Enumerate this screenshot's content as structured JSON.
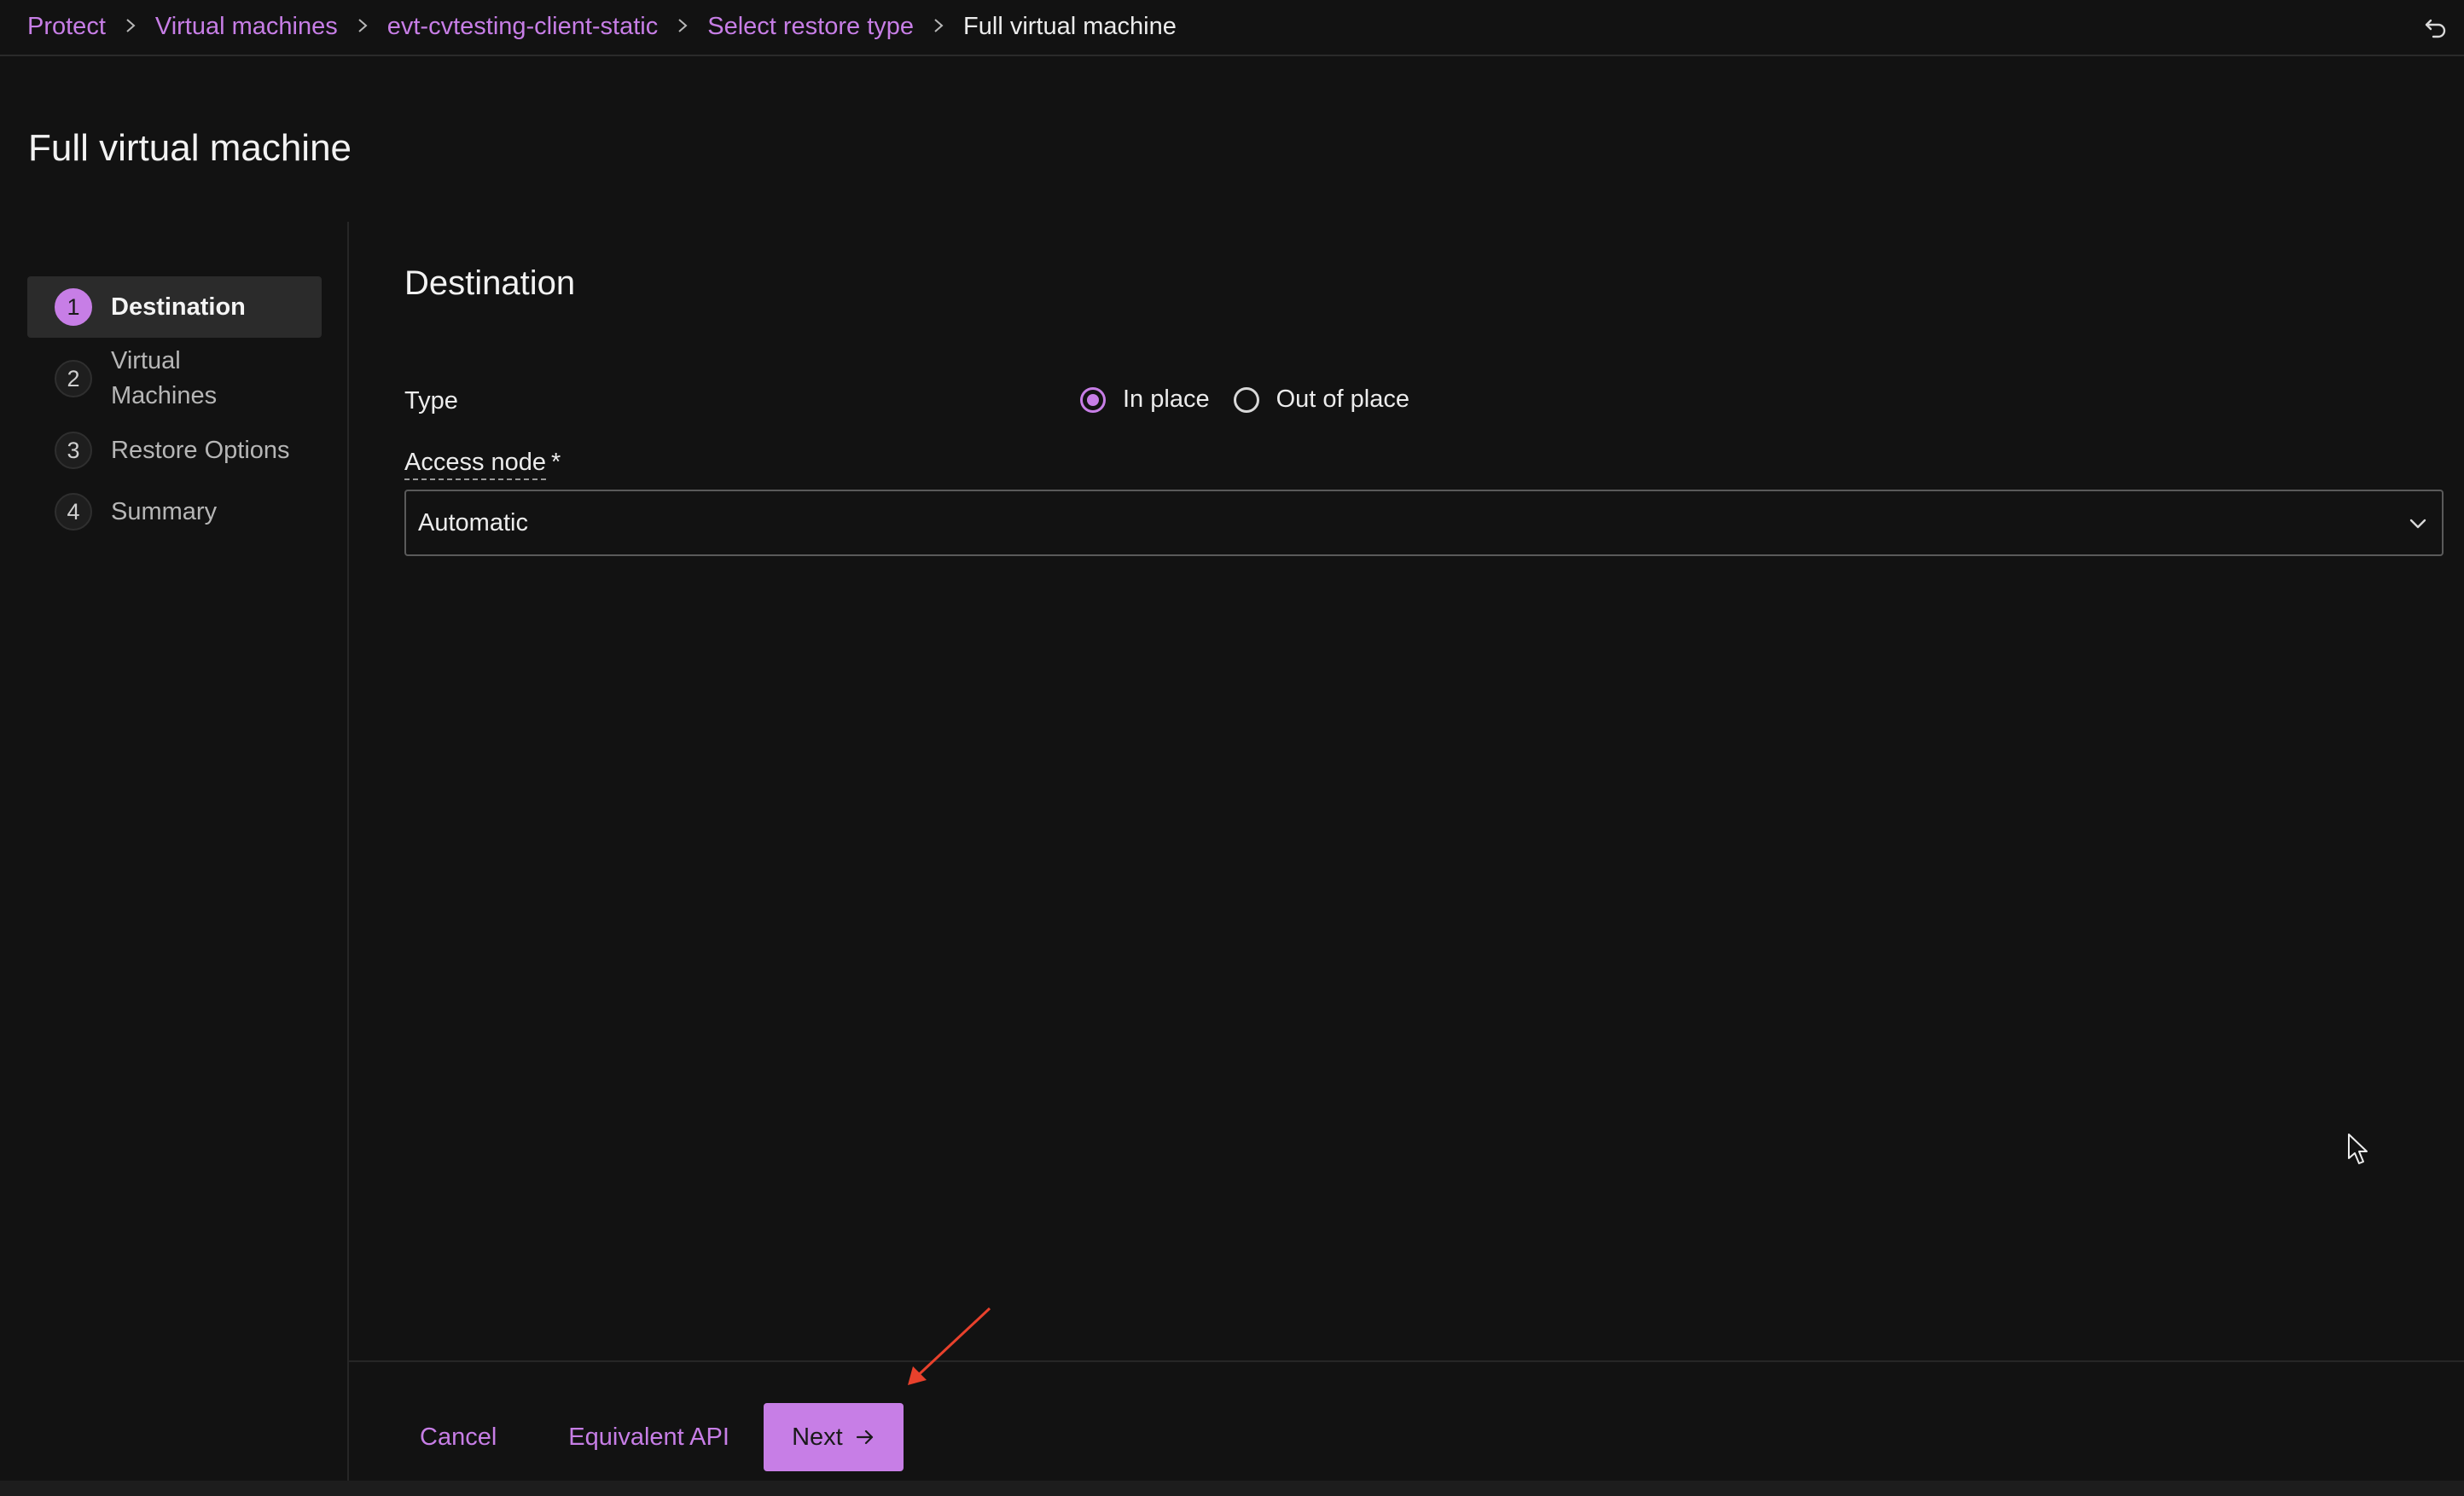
{
  "breadcrumb": {
    "items": [
      {
        "label": "Protect"
      },
      {
        "label": "Virtual machines"
      },
      {
        "label": "evt-cvtesting-client-static"
      },
      {
        "label": "Select restore type"
      }
    ],
    "current": "Full virtual machine",
    "separator": ">"
  },
  "page": {
    "title": "Full virtual machine"
  },
  "stepper": {
    "steps": [
      {
        "number": "1",
        "label": "Destination"
      },
      {
        "number": "2",
        "label": "Virtual Machines"
      },
      {
        "number": "3",
        "label": "Restore Options"
      },
      {
        "number": "4",
        "label": "Summary"
      }
    ],
    "active_step": 1
  },
  "destination": {
    "title": "Destination",
    "type_label": "Type",
    "type_options": [
      {
        "label": "In place",
        "selected": true
      },
      {
        "label": "Out of place",
        "selected": false
      }
    ],
    "access_node_label": "Access node",
    "access_node_required_marker": "*",
    "access_node_value": "Automatic"
  },
  "footer": {
    "cancel_label": "Cancel",
    "api_label": "Equivalent API",
    "next_label": "Next"
  },
  "colors": {
    "accent": "#c77ee6",
    "background": "#121212",
    "annotation": "#e8412c"
  },
  "icons": {
    "undo": "undo-icon",
    "chevron": "chevron-down-icon",
    "next_arrow": "arrow-right-icon",
    "cursor": "mouse-cursor-icon"
  }
}
